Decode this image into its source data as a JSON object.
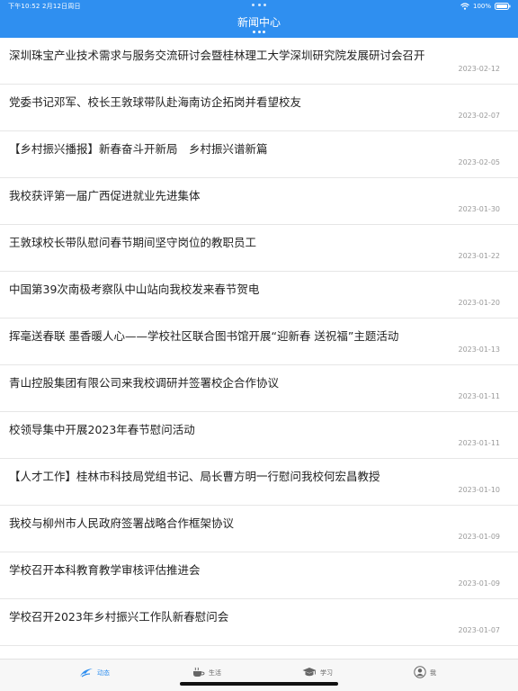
{
  "status_bar": {
    "time": "下午10:52  2月12日周日",
    "battery": "100%"
  },
  "header": {
    "title": "新闻中心"
  },
  "news": [
    {
      "title": "深圳珠宝产业技术需求与服务交流研讨会暨桂林理工大学深圳研究院发展研讨会召开",
      "date": "2023-02-12"
    },
    {
      "title": "党委书记邓军、校长王敦球带队赴海南访企拓岗并看望校友",
      "date": "2023-02-07"
    },
    {
      "title": "【乡村振兴播报】新春奋斗开新局　乡村振兴谱新篇",
      "date": "2023-02-05"
    },
    {
      "title": "我校获评第一届广西促进就业先进集体",
      "date": "2023-01-30"
    },
    {
      "title": "王敦球校长带队慰问春节期间坚守岗位的教职员工",
      "date": "2023-01-22"
    },
    {
      "title": "中国第39次南极考察队中山站向我校发来春节贺电",
      "date": "2023-01-20"
    },
    {
      "title": "挥毫送春联 墨香暖人心——学校社区联合图书馆开展“迎新春 送祝福”主题活动",
      "date": "2023-01-13"
    },
    {
      "title": "青山控股集团有限公司来我校调研并签署校企合作协议",
      "date": "2023-01-11"
    },
    {
      "title": "校领导集中开展2023年春节慰问活动",
      "date": "2023-01-11"
    },
    {
      "title": "【人才工作】桂林市科技局党组书记、局长曹方明一行慰问我校何宏昌教授",
      "date": "2023-01-10"
    },
    {
      "title": "我校与柳州市人民政府签署战略合作框架协议",
      "date": "2023-01-09"
    },
    {
      "title": "学校召开本科教育教学审核评估推进会",
      "date": "2023-01-09"
    },
    {
      "title": "学校召开2023年乡村振兴工作队新春慰问会",
      "date": "2023-01-07"
    }
  ],
  "tabbar": {
    "tabs": [
      {
        "label": "动态",
        "icon": "swoosh-icon",
        "active": true
      },
      {
        "label": "生活",
        "icon": "coffee-cup-icon",
        "active": false
      },
      {
        "label": "学习",
        "icon": "graduation-cap-icon",
        "active": false
      },
      {
        "label": "我",
        "icon": "user-icon",
        "active": false
      }
    ]
  },
  "colors": {
    "accent": "#2f8ff0",
    "text": "#222222",
    "date": "#9a9a9a"
  }
}
